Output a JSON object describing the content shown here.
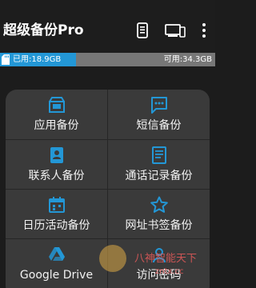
{
  "app": {
    "title": "超级备份Pro",
    "toolbar": {
      "icons": [
        "backup-device-icon",
        "devices-icon",
        "more-vert-icon"
      ]
    }
  },
  "storage": {
    "used_label": "已用:18.9GB",
    "available_label": "可用:34.3GB",
    "used_fraction": 0.355,
    "fill_color": "#2397d6",
    "track_color": "#777777"
  },
  "menu": {
    "accent": "#2397d6",
    "items": [
      {
        "label": "应用备份",
        "icon": "app-icon"
      },
      {
        "label": "短信备份",
        "icon": "sms-icon"
      },
      {
        "label": "联系人备份",
        "icon": "contacts-icon"
      },
      {
        "label": "通话记录备份",
        "icon": "call-log-icon"
      },
      {
        "label": "日历活动备份",
        "icon": "calendar-icon"
      },
      {
        "label": "网址书签备份",
        "icon": "star-icon"
      },
      {
        "label": "Google Drive",
        "icon": "google-drive-icon"
      },
      {
        "label": "访问密码",
        "icon": "password-icon"
      }
    ]
  },
  "watermark": {
    "line1": "八神智能天下",
    "line2": "zntx.cc"
  }
}
